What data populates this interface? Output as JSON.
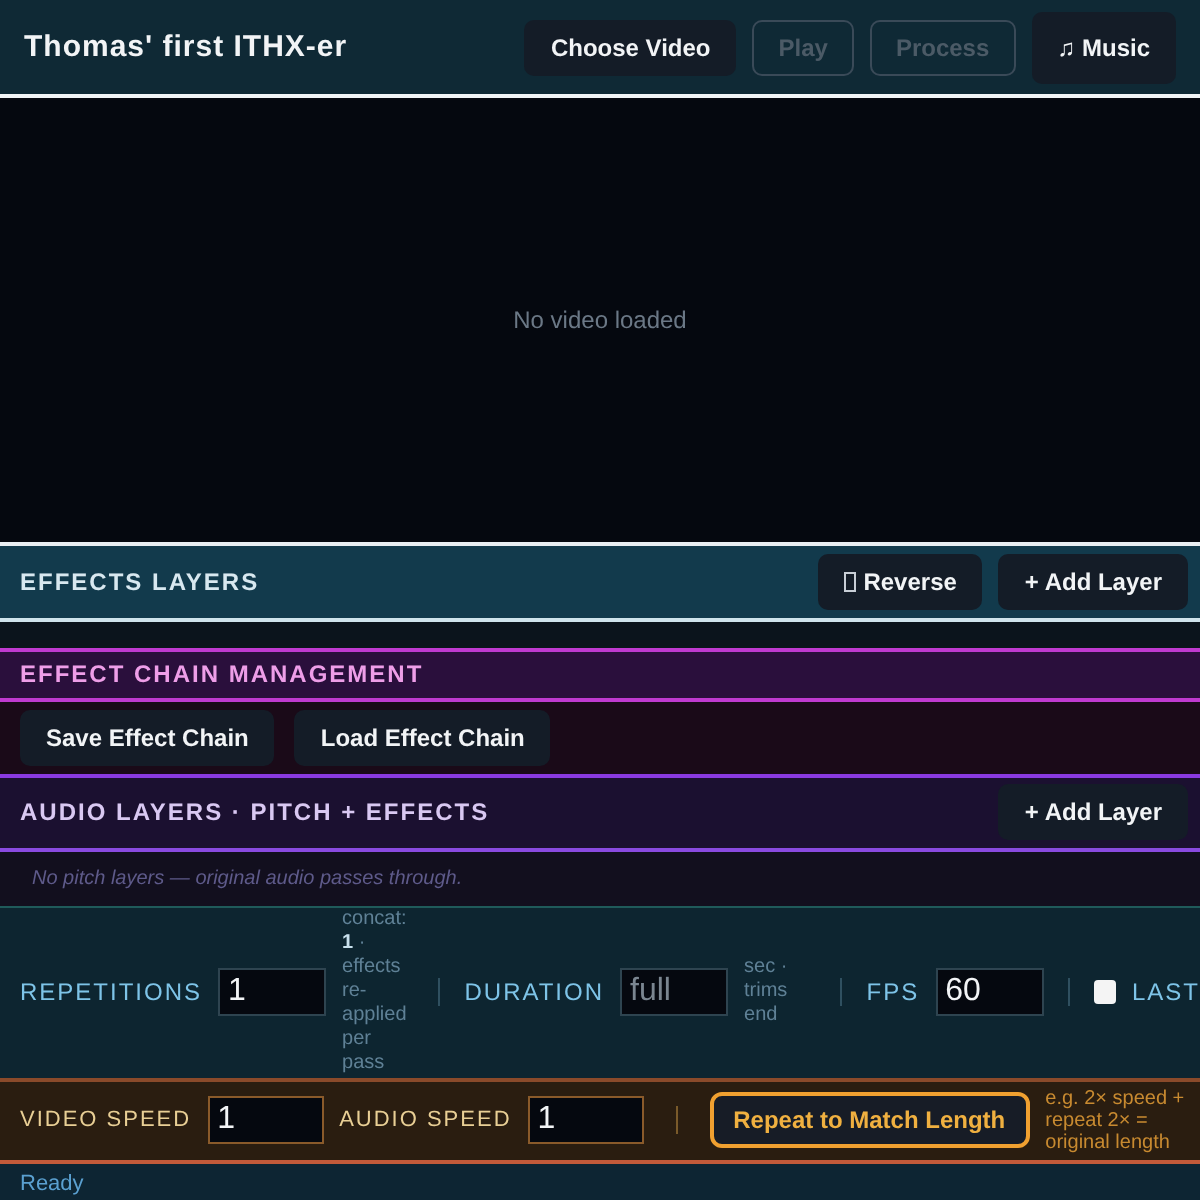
{
  "header": {
    "title": "Thomas' first ITHX-er",
    "buttons": [
      {
        "label": "Choose Video",
        "disabled": false,
        "kind": "plain"
      },
      {
        "label": "Play",
        "disabled": true,
        "kind": "plain"
      },
      {
        "label": "Process",
        "disabled": true,
        "kind": "plain"
      },
      {
        "label": "♫ Music",
        "disabled": false,
        "kind": "raised"
      }
    ]
  },
  "video": {
    "message": "No video loaded"
  },
  "effects_layers": {
    "title": "EFFECTS LAYERS",
    "buttons": [
      {
        "label": "Reverse",
        "kind": "icon"
      },
      {
        "label": "+ Add Layer",
        "kind": "plain"
      }
    ]
  },
  "effect_chain": {
    "title": "EFFECT CHAIN MANAGEMENT",
    "buttons": [
      "Save Effect Chain",
      "Load Effect Chain"
    ]
  },
  "audio_layers": {
    "title": "AUDIO LAYERS · PITCH + EFFECTS",
    "button": "+ Add Layer",
    "note": "No pitch layers — original audio passes through."
  },
  "settings": [
    {
      "kind": "field",
      "label": "REPETITIONS",
      "value": "1",
      "hint": "concat: **1** · effects re-applied per pass"
    },
    {
      "kind": "field",
      "label": "DURATION",
      "placeholder": "full",
      "hint": "sec · trims end"
    },
    {
      "kind": "field",
      "label": "FPS",
      "value": "60"
    },
    {
      "kind": "checkbox",
      "label": "LAST",
      "checked": false
    }
  ],
  "speed": {
    "video_label": "VIDEO SPEED",
    "video_value": "1",
    "audio_label": "AUDIO SPEED",
    "audio_value": "1",
    "button": "Repeat to Match Length",
    "hint": "e.g. 2× speed + repeat 2× = original length"
  },
  "status_bar": {
    "text": "Ready"
  }
}
